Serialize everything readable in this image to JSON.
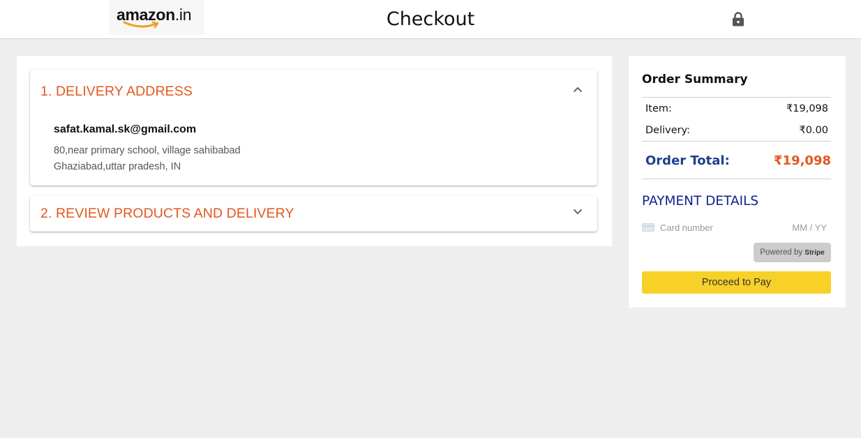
{
  "header": {
    "logo_wordmark": "amazon",
    "logo_suffix": ".in",
    "title": "Checkout",
    "lock_icon": "lock-icon"
  },
  "sections": [
    {
      "title": "1. DELIVERY ADDRESS",
      "expanded": true,
      "toggle_icon": "chevron-up-icon",
      "email": "safat.kamal.sk@gmail.com",
      "address_line1": "80,near primary school, village sahibabad",
      "address_line2": "Ghaziabad,uttar pradesh, IN"
    },
    {
      "title": "2. REVIEW PRODUCTS AND DELIVERY",
      "expanded": false,
      "toggle_icon": "chevron-down-icon"
    }
  ],
  "order_summary": {
    "title": "Order Summary",
    "item_label": "Item:",
    "item_value": "₹19,098",
    "delivery_label": "Delivery:",
    "delivery_value": "₹0.00",
    "total_label": "Order Total:",
    "total_value": "₹19,098"
  },
  "payment": {
    "title": "PAYMENT DETAILS",
    "card_icon": "credit-card-icon",
    "card_placeholder": "Card number",
    "expiry_placeholder": "MM / YY",
    "powered_by": "Powered by",
    "powered_brand": "Stripe",
    "button_label": "Proceed to Pay"
  },
  "colors": {
    "accent_orange": "#e2571e",
    "total_blue": "#1f3f8a",
    "payment_title_blue": "#12248a",
    "pay_button": "#f7d127",
    "background": "#eeeeee"
  }
}
